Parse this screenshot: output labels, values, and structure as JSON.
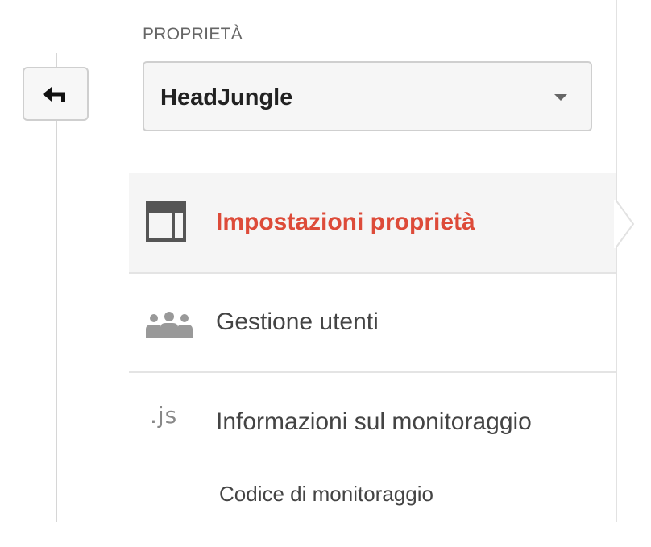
{
  "property_section": {
    "label": "PROPRIETÀ",
    "selected_property": "HeadJungle"
  },
  "back_button": {
    "icon": "back-arrow-icon"
  },
  "menu": {
    "items": [
      {
        "label": "Impostazioni proprietà",
        "icon": "layout-icon",
        "active": true
      },
      {
        "label": "Gestione utenti",
        "icon": "users-group-icon",
        "active": false
      },
      {
        "label": "Informazioni sul monitoraggio",
        "icon": "js-icon",
        "icon_text": ".js",
        "active": false
      }
    ],
    "sub_items": [
      {
        "label": "Codice di monitoraggio"
      }
    ]
  },
  "colors": {
    "active_text": "#dd4b39",
    "text": "#444444",
    "icon": "#555555",
    "border": "#cfcfcf"
  }
}
